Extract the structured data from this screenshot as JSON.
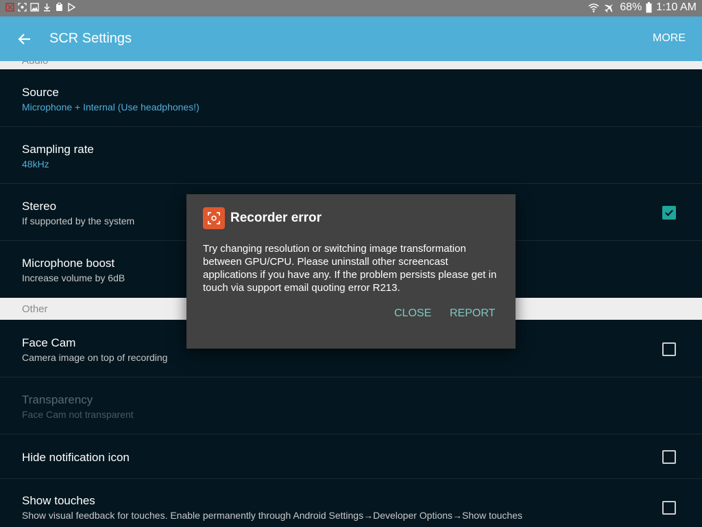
{
  "status_bar": {
    "battery": "68%",
    "time": "1:10 AM",
    "left_icons": [
      "notification-icon",
      "screenshot-icon",
      "image-icon",
      "download-icon",
      "clipboard-icon",
      "play-store-icon"
    ],
    "right_icons": [
      "wifi-icon",
      "airplane-icon",
      "battery-icon"
    ]
  },
  "appbar": {
    "title": "SCR Settings",
    "more_label": "MORE"
  },
  "sections": {
    "audio_header": "Audio",
    "other_header": "Other"
  },
  "rows": {
    "source": {
      "title": "Source",
      "summary": "Microphone + Internal (Use headphones!)"
    },
    "sampling": {
      "title": "Sampling rate",
      "summary": "48kHz"
    },
    "stereo": {
      "title": "Stereo",
      "summary": "If supported by the system",
      "checked": true
    },
    "mic_boost": {
      "title": "Microphone boost",
      "summary": "Increase volume by 6dB"
    },
    "face_cam": {
      "title": "Face Cam",
      "summary": "Camera image on top of recording",
      "checked": false
    },
    "transparency": {
      "title": "Transparency",
      "summary": "Face Cam not transparent"
    },
    "hide_notif": {
      "title": "Hide notification icon",
      "checked": false
    },
    "show_touches": {
      "title": "Show touches",
      "summary": "Show visual feedback for touches. Enable permanently through Android Settings→Developer Options→Show touches",
      "checked": false
    }
  },
  "dialog": {
    "title": "Recorder error",
    "message": "Try changing resolution or switching image transformation between GPU/CPU. Please uninstall other screencast applications if you have any. If the problem persists please get in touch via support email quoting error R213.",
    "close_label": "CLOSE",
    "report_label": "REPORT"
  },
  "colors": {
    "appbar": "#4fafd6",
    "background": "#04161f",
    "accent_text": "#53aedb",
    "checkbox_checked": "#1ea69a",
    "dialog_bg": "#424242",
    "dialog_button": "#7fc9c3"
  }
}
